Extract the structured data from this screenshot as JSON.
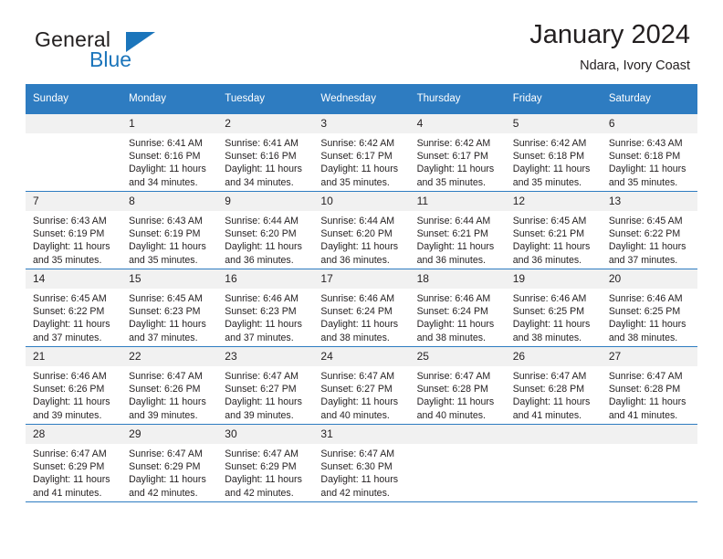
{
  "brand": {
    "name_part1": "General",
    "name_part2": "Blue",
    "accent_color": "#1b75bb"
  },
  "header": {
    "title": "January 2024",
    "subtitle": "Ndara, Ivory Coast"
  },
  "theme": {
    "header_row_color": "#2e7cc1",
    "daynum_bg": "#f1f1f1",
    "text_color": "#231f20"
  },
  "calendar": {
    "weekdays": [
      "Sunday",
      "Monday",
      "Tuesday",
      "Wednesday",
      "Thursday",
      "Friday",
      "Saturday"
    ],
    "weeks": [
      [
        {
          "day": "",
          "empty": true,
          "sunrise": "",
          "sunset": "",
          "daylight_line1": "",
          "daylight_line2": ""
        },
        {
          "day": "1",
          "sunrise": "Sunrise: 6:41 AM",
          "sunset": "Sunset: 6:16 PM",
          "daylight_line1": "Daylight: 11 hours",
          "daylight_line2": "and 34 minutes."
        },
        {
          "day": "2",
          "sunrise": "Sunrise: 6:41 AM",
          "sunset": "Sunset: 6:16 PM",
          "daylight_line1": "Daylight: 11 hours",
          "daylight_line2": "and 34 minutes."
        },
        {
          "day": "3",
          "sunrise": "Sunrise: 6:42 AM",
          "sunset": "Sunset: 6:17 PM",
          "daylight_line1": "Daylight: 11 hours",
          "daylight_line2": "and 35 minutes."
        },
        {
          "day": "4",
          "sunrise": "Sunrise: 6:42 AM",
          "sunset": "Sunset: 6:17 PM",
          "daylight_line1": "Daylight: 11 hours",
          "daylight_line2": "and 35 minutes."
        },
        {
          "day": "5",
          "sunrise": "Sunrise: 6:42 AM",
          "sunset": "Sunset: 6:18 PM",
          "daylight_line1": "Daylight: 11 hours",
          "daylight_line2": "and 35 minutes."
        },
        {
          "day": "6",
          "sunrise": "Sunrise: 6:43 AM",
          "sunset": "Sunset: 6:18 PM",
          "daylight_line1": "Daylight: 11 hours",
          "daylight_line2": "and 35 minutes."
        }
      ],
      [
        {
          "day": "7",
          "sunrise": "Sunrise: 6:43 AM",
          "sunset": "Sunset: 6:19 PM",
          "daylight_line1": "Daylight: 11 hours",
          "daylight_line2": "and 35 minutes."
        },
        {
          "day": "8",
          "sunrise": "Sunrise: 6:43 AM",
          "sunset": "Sunset: 6:19 PM",
          "daylight_line1": "Daylight: 11 hours",
          "daylight_line2": "and 35 minutes."
        },
        {
          "day": "9",
          "sunrise": "Sunrise: 6:44 AM",
          "sunset": "Sunset: 6:20 PM",
          "daylight_line1": "Daylight: 11 hours",
          "daylight_line2": "and 36 minutes."
        },
        {
          "day": "10",
          "sunrise": "Sunrise: 6:44 AM",
          "sunset": "Sunset: 6:20 PM",
          "daylight_line1": "Daylight: 11 hours",
          "daylight_line2": "and 36 minutes."
        },
        {
          "day": "11",
          "sunrise": "Sunrise: 6:44 AM",
          "sunset": "Sunset: 6:21 PM",
          "daylight_line1": "Daylight: 11 hours",
          "daylight_line2": "and 36 minutes."
        },
        {
          "day": "12",
          "sunrise": "Sunrise: 6:45 AM",
          "sunset": "Sunset: 6:21 PM",
          "daylight_line1": "Daylight: 11 hours",
          "daylight_line2": "and 36 minutes."
        },
        {
          "day": "13",
          "sunrise": "Sunrise: 6:45 AM",
          "sunset": "Sunset: 6:22 PM",
          "daylight_line1": "Daylight: 11 hours",
          "daylight_line2": "and 37 minutes."
        }
      ],
      [
        {
          "day": "14",
          "sunrise": "Sunrise: 6:45 AM",
          "sunset": "Sunset: 6:22 PM",
          "daylight_line1": "Daylight: 11 hours",
          "daylight_line2": "and 37 minutes."
        },
        {
          "day": "15",
          "sunrise": "Sunrise: 6:45 AM",
          "sunset": "Sunset: 6:23 PM",
          "daylight_line1": "Daylight: 11 hours",
          "daylight_line2": "and 37 minutes."
        },
        {
          "day": "16",
          "sunrise": "Sunrise: 6:46 AM",
          "sunset": "Sunset: 6:23 PM",
          "daylight_line1": "Daylight: 11 hours",
          "daylight_line2": "and 37 minutes."
        },
        {
          "day": "17",
          "sunrise": "Sunrise: 6:46 AM",
          "sunset": "Sunset: 6:24 PM",
          "daylight_line1": "Daylight: 11 hours",
          "daylight_line2": "and 38 minutes."
        },
        {
          "day": "18",
          "sunrise": "Sunrise: 6:46 AM",
          "sunset": "Sunset: 6:24 PM",
          "daylight_line1": "Daylight: 11 hours",
          "daylight_line2": "and 38 minutes."
        },
        {
          "day": "19",
          "sunrise": "Sunrise: 6:46 AM",
          "sunset": "Sunset: 6:25 PM",
          "daylight_line1": "Daylight: 11 hours",
          "daylight_line2": "and 38 minutes."
        },
        {
          "day": "20",
          "sunrise": "Sunrise: 6:46 AM",
          "sunset": "Sunset: 6:25 PM",
          "daylight_line1": "Daylight: 11 hours",
          "daylight_line2": "and 38 minutes."
        }
      ],
      [
        {
          "day": "21",
          "sunrise": "Sunrise: 6:46 AM",
          "sunset": "Sunset: 6:26 PM",
          "daylight_line1": "Daylight: 11 hours",
          "daylight_line2": "and 39 minutes."
        },
        {
          "day": "22",
          "sunrise": "Sunrise: 6:47 AM",
          "sunset": "Sunset: 6:26 PM",
          "daylight_line1": "Daylight: 11 hours",
          "daylight_line2": "and 39 minutes."
        },
        {
          "day": "23",
          "sunrise": "Sunrise: 6:47 AM",
          "sunset": "Sunset: 6:27 PM",
          "daylight_line1": "Daylight: 11 hours",
          "daylight_line2": "and 39 minutes."
        },
        {
          "day": "24",
          "sunrise": "Sunrise: 6:47 AM",
          "sunset": "Sunset: 6:27 PM",
          "daylight_line1": "Daylight: 11 hours",
          "daylight_line2": "and 40 minutes."
        },
        {
          "day": "25",
          "sunrise": "Sunrise: 6:47 AM",
          "sunset": "Sunset: 6:28 PM",
          "daylight_line1": "Daylight: 11 hours",
          "daylight_line2": "and 40 minutes."
        },
        {
          "day": "26",
          "sunrise": "Sunrise: 6:47 AM",
          "sunset": "Sunset: 6:28 PM",
          "daylight_line1": "Daylight: 11 hours",
          "daylight_line2": "and 41 minutes."
        },
        {
          "day": "27",
          "sunrise": "Sunrise: 6:47 AM",
          "sunset": "Sunset: 6:28 PM",
          "daylight_line1": "Daylight: 11 hours",
          "daylight_line2": "and 41 minutes."
        }
      ],
      [
        {
          "day": "28",
          "sunrise": "Sunrise: 6:47 AM",
          "sunset": "Sunset: 6:29 PM",
          "daylight_line1": "Daylight: 11 hours",
          "daylight_line2": "and 41 minutes."
        },
        {
          "day": "29",
          "sunrise": "Sunrise: 6:47 AM",
          "sunset": "Sunset: 6:29 PM",
          "daylight_line1": "Daylight: 11 hours",
          "daylight_line2": "and 42 minutes."
        },
        {
          "day": "30",
          "sunrise": "Sunrise: 6:47 AM",
          "sunset": "Sunset: 6:29 PM",
          "daylight_line1": "Daylight: 11 hours",
          "daylight_line2": "and 42 minutes."
        },
        {
          "day": "31",
          "sunrise": "Sunrise: 6:47 AM",
          "sunset": "Sunset: 6:30 PM",
          "daylight_line1": "Daylight: 11 hours",
          "daylight_line2": "and 42 minutes."
        },
        {
          "day": "",
          "empty": true,
          "sunrise": "",
          "sunset": "",
          "daylight_line1": "",
          "daylight_line2": ""
        },
        {
          "day": "",
          "empty": true,
          "sunrise": "",
          "sunset": "",
          "daylight_line1": "",
          "daylight_line2": ""
        },
        {
          "day": "",
          "empty": true,
          "sunrise": "",
          "sunset": "",
          "daylight_line1": "",
          "daylight_line2": ""
        }
      ]
    ]
  }
}
